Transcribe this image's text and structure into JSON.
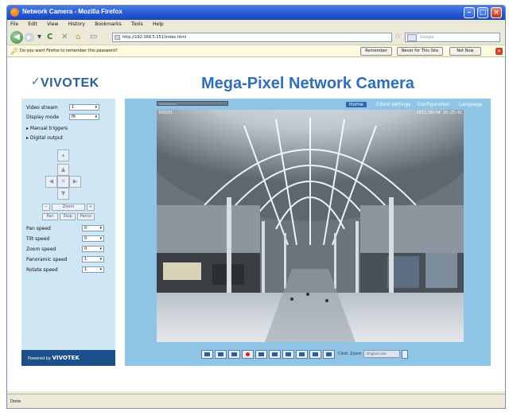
{
  "window": {
    "title": "Network Camera - Mozilla Firefox"
  },
  "menu": [
    "File",
    "Edit",
    "View",
    "History",
    "Bookmarks",
    "Tools",
    "Help"
  ],
  "nav": {
    "url": "http://192.168.5.151/index.html",
    "search_placeholder": "Google"
  },
  "notification": {
    "message": "Do you want Firefox to remember this password?",
    "remember": "Remember",
    "never": "Never for This Site",
    "not_now": "Not Now"
  },
  "brand": {
    "logo": "VIVOTEK",
    "headline": "Mega-Pixel Network Camera"
  },
  "left": {
    "video_stream_label": "Video stream",
    "video_stream_value": "1",
    "display_mode_label": "Display mode",
    "display_mode_value": "fit",
    "manual_triggers": "Manual triggers",
    "digital_output": "Digital output",
    "zoom_label": "Zoom",
    "pan": "Pan",
    "stop": "Stop",
    "patrol": "Patrol",
    "speeds": [
      {
        "label": "Pan speed",
        "value": "0"
      },
      {
        "label": "Tilt speed",
        "value": "0"
      },
      {
        "label": "Zoom speed",
        "value": "0"
      },
      {
        "label": "Panoramic speed",
        "value": "1"
      },
      {
        "label": "Rotate speed",
        "value": "1"
      }
    ],
    "powered_by": "Powered by",
    "powered_brand": "VIVOTEK"
  },
  "topnav": {
    "home": "Home",
    "client": "Client settings",
    "config": "Configuration",
    "language": "Language"
  },
  "video": {
    "osd_left": "IP8151",
    "osd_right": "2011/08/04 10:25:41"
  },
  "controls": {
    "zoom_label": "Click: Zoom",
    "zoom_value": "Original size"
  },
  "status": {
    "text": "Done"
  }
}
